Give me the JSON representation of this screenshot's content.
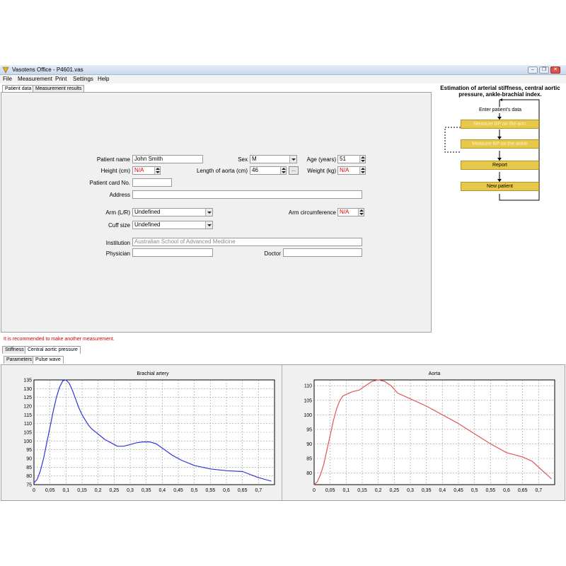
{
  "window": {
    "title": "Vasotens Office - P4601.vas",
    "icon": "app-icon",
    "minimize": "minimize-icon",
    "restore": "restore-icon",
    "close": "close-icon"
  },
  "menu": [
    "File",
    "Measurement",
    "Print",
    "Settings",
    "Help"
  ],
  "top_tabs": [
    "Patient data",
    "Measurement results"
  ],
  "patient": {
    "name_label": "Patient name",
    "name_value": "John Smith",
    "sex_label": "Sex",
    "sex_value": "M",
    "age_label": "Age (years)",
    "age_value": "51",
    "height_label": "Height (cm)",
    "height_value": "N/A",
    "aorta_label": "Length of aorta (cm)",
    "aorta_value": "46",
    "aorta_button": "...",
    "weight_label": "Weight (kg)",
    "weight_value": "N/A",
    "card_label": "Patient card No.",
    "card_value": "",
    "address_label": "Address",
    "address_value": "",
    "arm_label": "Arm (L/R)",
    "arm_value": "Undefined",
    "arm_circ_label": "Arm circumference",
    "arm_circ_value": "N/A",
    "cuff_label": "Cuff size",
    "cuff_value": "Undefined",
    "institution_label": "Institution",
    "institution_value": "Australian School of Advanced Medicine",
    "physician_label": "Physician",
    "physician_value": "",
    "doctor_label": "Doctor",
    "doctor_value": ""
  },
  "flowchart": {
    "title_line1": "Estimation of arterial stiffness, central aortic",
    "title_line2": "pressure, ankle-brachial index.",
    "step_enter": "Enter patient's data",
    "step_brachial": "Measure BP on the arm",
    "step_ankle": "Measure BP on the ankle",
    "step_report": "Report",
    "step_new": "New patient"
  },
  "warning": "It is recommended to make another measurement.",
  "result_tabs": [
    "Stiffness",
    "Central aortic pressure"
  ],
  "sub_tabs": [
    "Parameters",
    "Pulse wave"
  ],
  "colors": {
    "brachial": "#3333dd",
    "aorta": "#e05555",
    "flow_box": "#e8c84a",
    "warning": "#d00000"
  },
  "chart_data": [
    {
      "type": "line",
      "title": "Brachial artery",
      "xlim": [
        0,
        0.75
      ],
      "ylim": [
        75,
        135
      ],
      "xticks": [
        "0",
        "0,05",
        "0,1",
        "0,15",
        "0,2",
        "0,25",
        "0,3",
        "0,35",
        "0,4",
        "0,45",
        "0,5",
        "0,55",
        "0,6",
        "0,65",
        "0,7"
      ],
      "yticks": [
        "75",
        "80",
        "85",
        "90",
        "95",
        "100",
        "105",
        "110",
        "115",
        "120",
        "125",
        "130",
        "135"
      ],
      "series": [
        {
          "x": [
            0,
            0.01,
            0.02,
            0.03,
            0.04,
            0.05,
            0.06,
            0.07,
            0.08,
            0.09,
            0.1,
            0.11,
            0.12,
            0.13,
            0.14,
            0.15,
            0.16,
            0.17,
            0.18,
            0.19,
            0.2,
            0.22,
            0.24,
            0.26,
            0.28,
            0.3,
            0.32,
            0.34,
            0.36,
            0.38,
            0.4,
            0.43,
            0.46,
            0.5,
            0.55,
            0.6,
            0.65,
            0.7,
            0.74
          ],
          "y": [
            76,
            78,
            83,
            90,
            99,
            108,
            117,
            125,
            131,
            134.5,
            135,
            133,
            129,
            124,
            119,
            115,
            112,
            109,
            107,
            105.5,
            104,
            101,
            99,
            97,
            97,
            98,
            99,
            99.5,
            99.5,
            98.5,
            96,
            92,
            89,
            86,
            84,
            83,
            82.5,
            79,
            77
          ]
        }
      ]
    },
    {
      "type": "line",
      "title": "Aorta",
      "xlim": [
        0,
        0.75
      ],
      "ylim": [
        76,
        112
      ],
      "xticks": [
        "0",
        "0,05",
        "0,1",
        "0,15",
        "0,2",
        "0,25",
        "0,3",
        "0,35",
        "0,4",
        "0,45",
        "0,5",
        "0,55",
        "0,6",
        "0,65",
        "0,7"
      ],
      "yticks": [
        "80",
        "85",
        "90",
        "95",
        "100",
        "105",
        "110"
      ],
      "series": [
        {
          "x": [
            0,
            0.01,
            0.02,
            0.03,
            0.04,
            0.05,
            0.06,
            0.07,
            0.08,
            0.09,
            0.1,
            0.12,
            0.14,
            0.16,
            0.18,
            0.2,
            0.22,
            0.24,
            0.26,
            0.3,
            0.35,
            0.4,
            0.45,
            0.5,
            0.55,
            0.6,
            0.65,
            0.68,
            0.7,
            0.72,
            0.74
          ],
          "y": [
            76,
            77,
            79.5,
            83,
            88,
            93,
            98,
            102,
            105,
            106.5,
            107,
            108,
            108.5,
            110,
            111.5,
            112,
            111.5,
            110,
            107.5,
            105.5,
            103,
            100,
            97,
            93.5,
            90,
            87,
            85.5,
            84,
            82,
            80,
            78
          ]
        }
      ]
    }
  ]
}
